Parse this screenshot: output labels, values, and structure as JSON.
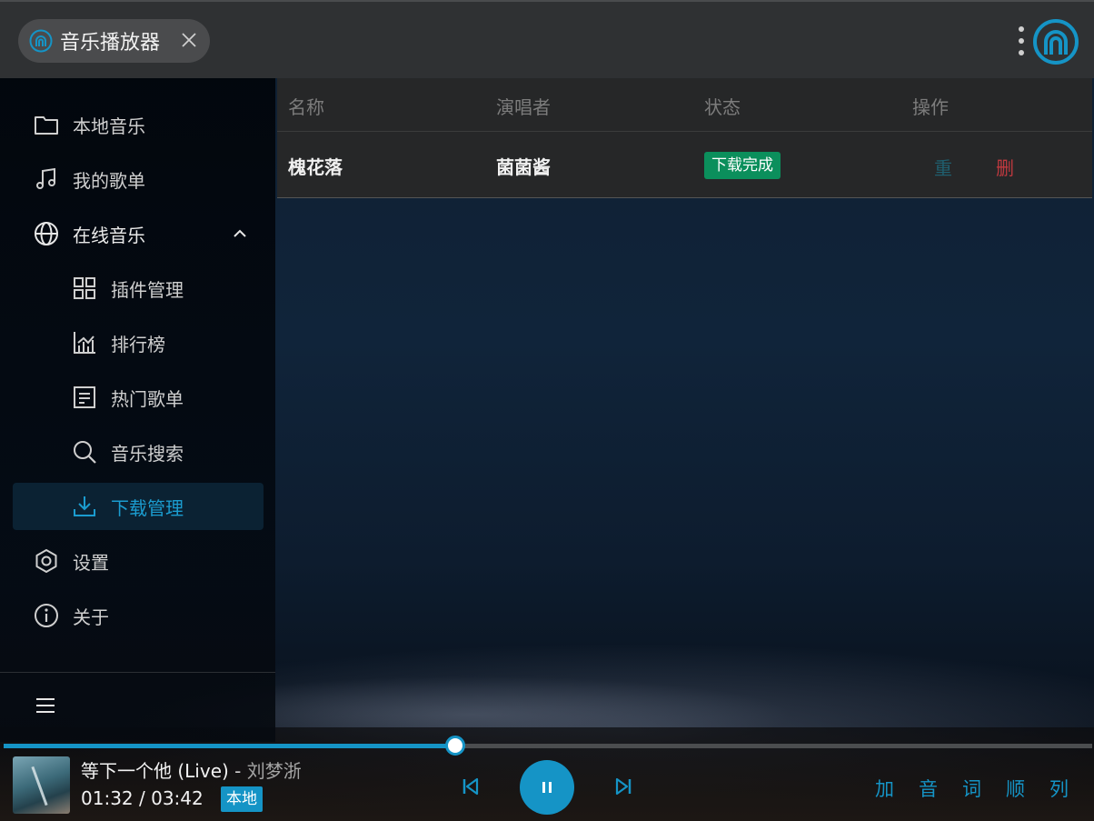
{
  "window": {
    "tab_title": "音乐播放器"
  },
  "sidebar": {
    "items": [
      {
        "label": "本地音乐",
        "icon": "folder-icon"
      },
      {
        "label": "我的歌单",
        "icon": "music-note-icon"
      },
      {
        "label": "在线音乐",
        "icon": "globe-icon",
        "expanded": true
      },
      {
        "label": "插件管理",
        "icon": "grid-icon"
      },
      {
        "label": "排行榜",
        "icon": "bar-chart-icon"
      },
      {
        "label": "热门歌单",
        "icon": "playlist-icon"
      },
      {
        "label": "音乐搜索",
        "icon": "search-icon"
      },
      {
        "label": "下载管理",
        "icon": "download-icon",
        "active": true
      },
      {
        "label": "设置",
        "icon": "settings-hexagon-icon"
      },
      {
        "label": "关于",
        "icon": "info-icon"
      }
    ]
  },
  "downloads": {
    "headers": [
      "名称",
      "演唱者",
      "状态",
      "操作"
    ],
    "rows": [
      {
        "name": "槐花落",
        "artist": "菌菌酱",
        "status": "下载完成",
        "actions": {
          "retry": "重",
          "delete": "删"
        }
      }
    ]
  },
  "player": {
    "title": "等下一个他 (Live)",
    "separator": " - ",
    "artist": "刘梦浙",
    "time": "01:32 / 03:42",
    "source": "本地",
    "progress": 0.415,
    "right_buttons": [
      "加",
      "音",
      "词",
      "顺",
      "列"
    ]
  },
  "colors": {
    "accent": "#1594c6",
    "status_done": "#0b8f5c",
    "delete": "#c0393f"
  }
}
